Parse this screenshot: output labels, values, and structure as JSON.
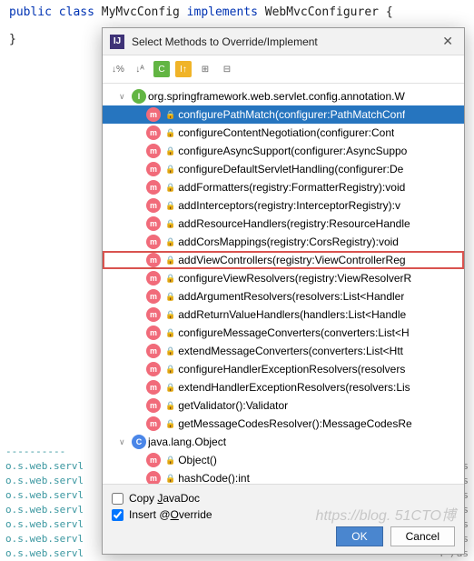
{
  "code": {
    "line1_pre": "public class ",
    "line1_cls": "MyMvcConfig ",
    "line1_impl": "implements ",
    "line1_iface": "WebMvcConfigurer {",
    "line3": "}"
  },
  "dialog": {
    "title": "Select Methods to Override/Implement"
  },
  "tree": {
    "root1": "org.springframework.web.servlet.config.annotation.W",
    "root2": "java.lang.Object",
    "methods1": [
      "configurePathMatch(configurer:PathMatchConf",
      "configureContentNegotiation(configurer:Cont",
      "configureAsyncSupport(configurer:AsyncSuppo",
      "configureDefaultServletHandling(configurer:De",
      "addFormatters(registry:FormatterRegistry):void",
      "addInterceptors(registry:InterceptorRegistry):v",
      "addResourceHandlers(registry:ResourceHandle",
      "addCorsMappings(registry:CorsRegistry):void",
      "addViewControllers(registry:ViewControllerReg",
      "configureViewResolvers(registry:ViewResolverR",
      "addArgumentResolvers(resolvers:List<Handler",
      "addReturnValueHandlers(handlers:List<Handle",
      "configureMessageConverters(converters:List<H",
      "extendMessageConverters(converters:List<Htt",
      "configureHandlerExceptionResolvers(resolvers",
      "extendHandlerExceptionResolvers(resolvers:Lis",
      "getValidator():Validator",
      "getMessageCodesResolver():MessageCodesRe"
    ],
    "methods2": [
      "Object()",
      "hashCode():int"
    ]
  },
  "footer": {
    "copy_javadoc": "Copy JavaDoc",
    "insert_override": "Insert @Override",
    "ok": "OK",
    "cancel": "Cancel"
  },
  "log": {
    "prefix": "o.s.web.servl",
    "right": "T /as",
    "dots": "----------"
  },
  "watermark": "https://blog.    51CTO博"
}
